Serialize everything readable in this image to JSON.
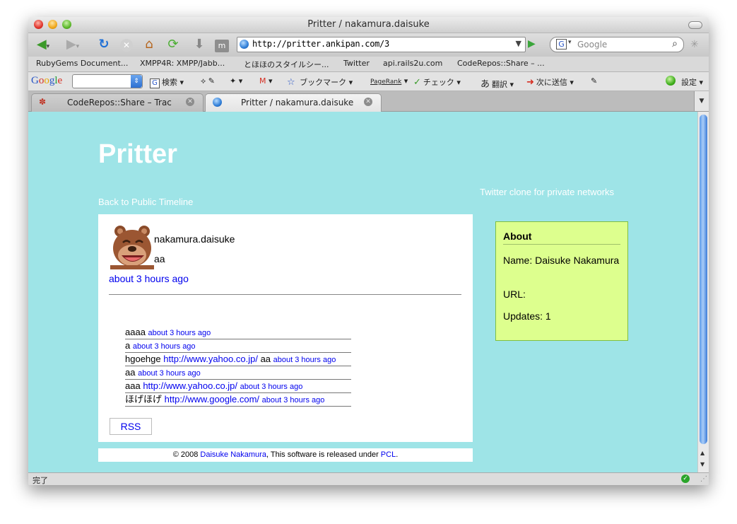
{
  "window": {
    "title": "Pritter / nakamura.daisuke"
  },
  "nav": {
    "url": "http://pritter.ankipan.com/3",
    "search_placeholder": "Google",
    "search_engine_letter": "G"
  },
  "bookmarks": [
    "RubyGems Document...",
    "XMPP4R: XMPP/Jabb...",
    "とほほのスタイルシー...",
    "Twitter",
    "api.rails2u.com",
    "CodeRepos::Share – ..."
  ],
  "google_toolbar": {
    "logo": [
      "G",
      "o",
      "o",
      "g",
      "l",
      "e"
    ],
    "search": "検索",
    "bookmarks": "ブックマーク",
    "pagerank": "PageRank",
    "check": "チェック",
    "translate": "翻訳",
    "send": "次に送信",
    "settings": "設定"
  },
  "tabs": [
    {
      "label": "CodeRepos::Share – Trac",
      "active": false,
      "icon": "paw-icon"
    },
    {
      "label": "Pritter / nakamura.daisuke",
      "active": true,
      "icon": "globe-icon"
    }
  ],
  "page": {
    "site_title": "Pritter",
    "tagline": "Twitter clone for private networks",
    "back_link": "Back to Public Timeline",
    "latest": {
      "user": "nakamura.daisuke",
      "text": "aa",
      "time": "about 3 hours ago"
    },
    "timeline": [
      {
        "text": "aaaa",
        "link": "",
        "after": "",
        "time": "about 3 hours ago"
      },
      {
        "text": "a",
        "link": "",
        "after": "",
        "time": "about 3 hours ago"
      },
      {
        "text": "hgoehge",
        "link": "http://www.yahoo.co.jp/",
        "after": "aa",
        "time": "about 3 hours ago"
      },
      {
        "text": "aa",
        "link": "",
        "after": "",
        "time": "about 3 hours ago"
      },
      {
        "text": "aaa",
        "link": "http://www.yahoo.co.jp/",
        "after": "",
        "time": "about 3 hours ago"
      },
      {
        "text": "ほげほげ",
        "link": "http://www.google.com/",
        "after": "",
        "time": "about 3 hours ago"
      }
    ],
    "rss": "RSS",
    "about": {
      "heading": "About",
      "name": "Name: Daisuke Nakamura",
      "url": "URL:",
      "updates": "Updates: 1"
    },
    "footer": {
      "prefix": "© 2008 ",
      "author": "Daisuke Nakamura",
      "middle": ", This software is released under ",
      "license": "PCL",
      "suffix": "."
    }
  },
  "status": {
    "text": "完了"
  },
  "colors": {
    "page_background": "#9ee4e7",
    "about_background": "#ddff8e",
    "link": "#0000ee"
  }
}
